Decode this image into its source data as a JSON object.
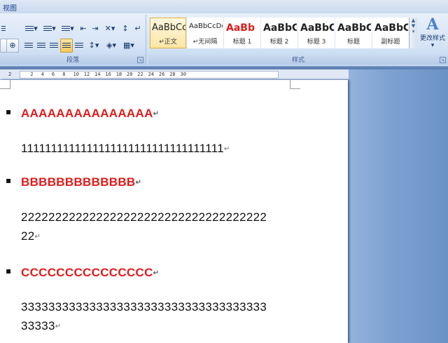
{
  "tabs": {
    "view": "视图"
  },
  "ribbon": {
    "paragraph_group": {
      "label": "段落"
    },
    "styles_group": {
      "label": "样式",
      "items": [
        {
          "preview": "AaBbCc",
          "name": "正文",
          "marker": "↵",
          "selected": true
        },
        {
          "preview": "AaBbCcDd",
          "name": "无间隔",
          "marker": "↵"
        },
        {
          "preview": "AaBb",
          "name": "标题 1",
          "color": "#d91f1f",
          "bold": true
        },
        {
          "preview": "AaBbC",
          "name": "标题 2",
          "bold": true
        },
        {
          "preview": "AaBbC",
          "name": "标题 3",
          "bold": true
        },
        {
          "preview": "AaBbC",
          "name": "标题",
          "bold": true
        },
        {
          "preview": "AaBbC",
          "name": "副标题",
          "bold": true
        }
      ],
      "change_styles_label": "更改样式",
      "change_styles_arrow": "▾"
    }
  },
  "ruler": {
    "ticks": [
      "2",
      "2",
      "4",
      "6",
      "8",
      "10",
      "12",
      "14",
      "16",
      "18",
      "20",
      "22",
      "24",
      "26",
      "28",
      "30"
    ]
  },
  "document": {
    "paragraph_mark": "↵",
    "bullet_char": "▪",
    "paragraphs": [
      {
        "type": "heading",
        "bullet": true,
        "text": "AAAAAAAAAAAAAAA"
      },
      {
        "type": "body",
        "text": "1111111111111111111111111111111111"
      },
      {
        "type": "heading",
        "bullet": true,
        "text": "BBBBBBBBBBBBB"
      },
      {
        "type": "body",
        "text": "222222222222222222222222222222222222",
        "line2": "22"
      },
      {
        "type": "heading",
        "bullet": true,
        "text": "CCCCCCCCCCCCCCC"
      },
      {
        "type": "body",
        "text": "333333333333333333333333333333333333",
        "line2": "33333"
      }
    ]
  }
}
